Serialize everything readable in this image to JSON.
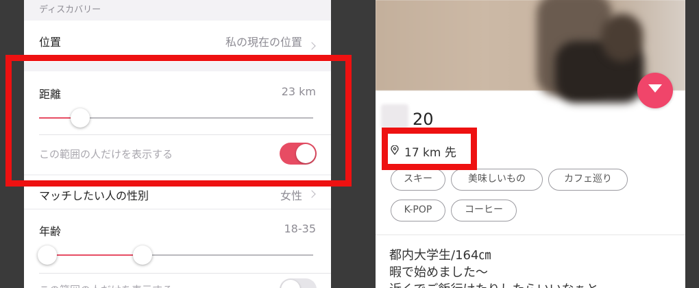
{
  "settings": {
    "section_header": "ディスカバリー",
    "location": {
      "label": "位置",
      "value": "私の現在の位置"
    },
    "distance": {
      "label": "距離",
      "value": "23 km",
      "slider_fraction": 0.15
    },
    "distance_toggle": {
      "label": "この範囲の人だけを表示する",
      "on": true
    },
    "gender": {
      "label": "マッチしたい人の性別",
      "value": "女性"
    },
    "age": {
      "label": "年齢",
      "value": "18-35",
      "min": 18,
      "max": 35
    },
    "age_toggle": {
      "label": "この範囲の人だけを表示する",
      "on": false
    }
  },
  "profile": {
    "age": "20",
    "distance": "17 km 先",
    "tags": [
      "スキー",
      "美味しいもの",
      "カフェ巡り",
      "K-POP",
      "コーヒー"
    ],
    "bio_lines": [
      "都内大学生/164㎝",
      "暇で始めました〜",
      "近くでご飯行けたりしたらいいなぁと"
    ]
  },
  "colors": {
    "accent": "#e74c63",
    "like": "#f0456a",
    "annotation": "#ee1111"
  },
  "icons": {
    "chevron": "chevron-right-icon",
    "pin": "location-pin-icon",
    "heart": "heart-icon"
  }
}
